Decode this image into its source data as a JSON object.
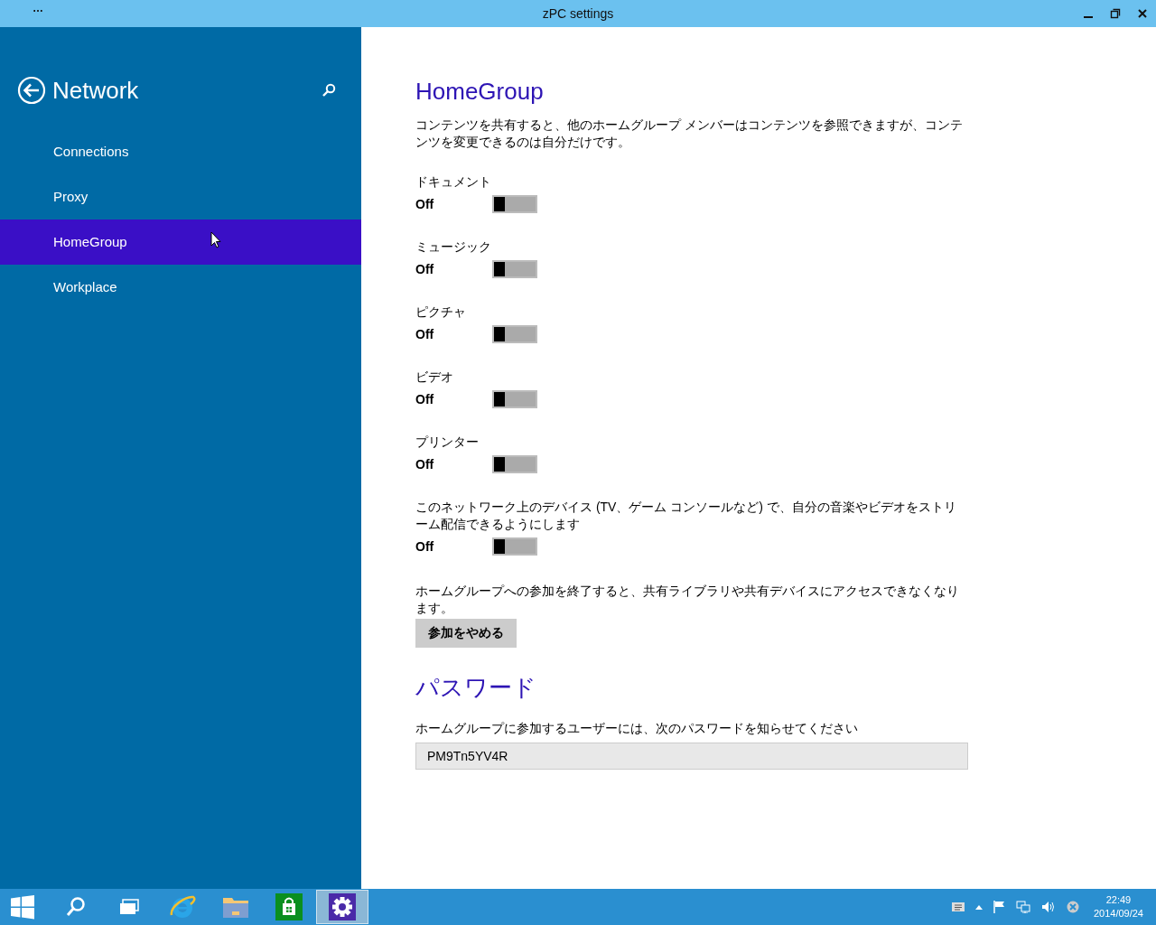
{
  "window": {
    "title": "zPC settings",
    "menu": "…"
  },
  "sidebar": {
    "title": "Network",
    "items": [
      {
        "label": "Connections",
        "selected": false
      },
      {
        "label": "Proxy",
        "selected": false
      },
      {
        "label": "HomeGroup",
        "selected": true
      },
      {
        "label": "Workplace",
        "selected": false
      }
    ]
  },
  "content": {
    "heading": "HomeGroup",
    "description": "コンテンツを共有すると、他のホームグループ メンバーはコンテンツを参照できますが、コンテンツを変更できるのは自分だけです。",
    "toggles": [
      {
        "label": "ドキュメント",
        "state": "Off",
        "on": false
      },
      {
        "label": "ミュージック",
        "state": "Off",
        "on": false
      },
      {
        "label": "ピクチャ",
        "state": "Off",
        "on": false
      },
      {
        "label": "ビデオ",
        "state": "Off",
        "on": false
      },
      {
        "label": "プリンター",
        "state": "Off",
        "on": false
      },
      {
        "label": "このネットワーク上のデバイス (TV、ゲーム コンソールなど) で、自分の音楽やビデオをストリーム配信できるようにします",
        "state": "Off",
        "on": false
      }
    ],
    "leave_text": "ホームグループへの参加を終了すると、共有ライブラリや共有デバイスにアクセスできなくなります。",
    "leave_button": "参加をやめる",
    "password_heading": "パスワード",
    "password_text": "ホームグループに参加するユーザーには、次のパスワードを知らせてください",
    "password": "PM9Tn5YV4R"
  },
  "taskbar": {
    "apps": [
      {
        "kind": "start",
        "selected": false
      },
      {
        "kind": "search",
        "selected": false
      },
      {
        "kind": "taskview",
        "selected": false
      },
      {
        "kind": "browser",
        "selected": false
      },
      {
        "kind": "folder",
        "selected": false
      },
      {
        "kind": "store",
        "selected": false
      },
      {
        "kind": "settings",
        "selected": true
      }
    ],
    "time": "22:49",
    "date": "2014/09/24"
  }
}
